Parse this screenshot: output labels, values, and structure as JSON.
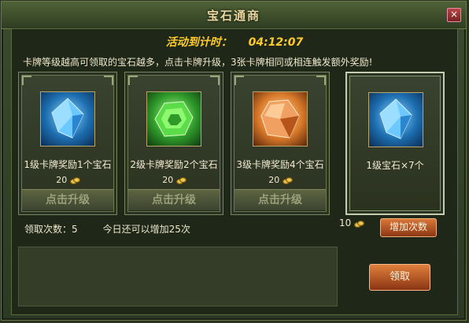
{
  "window": {
    "title": "宝石通商"
  },
  "timer": {
    "label": "活动到计时：",
    "value": "04:12:07"
  },
  "description": "卡牌等级越高可领取的宝石越多，点击卡牌升级，3张卡牌相同或相连触发额外奖励!",
  "cards": [
    {
      "label": "1级卡牌奖励1个宝石",
      "cost": "20",
      "button": "点击升级",
      "gem": "blue"
    },
    {
      "label": "2级卡牌奖励2个宝石",
      "cost": "20",
      "button": "点击升级",
      "gem": "green"
    },
    {
      "label": "3级卡牌奖励4个宝石",
      "cost": "20",
      "button": "点击升级",
      "gem": "orange"
    }
  ],
  "final_card": {
    "label": "1级宝石×7个",
    "gem": "blue"
  },
  "claim_count": {
    "label": "领取次数：",
    "value": "5"
  },
  "today_text": "今日还可以增加25次",
  "add_cost": "10",
  "add_button": "增加次数",
  "claim_button": "领取",
  "colors": {
    "accent": "#ffcb2b",
    "button_orange": "#d9773a"
  }
}
